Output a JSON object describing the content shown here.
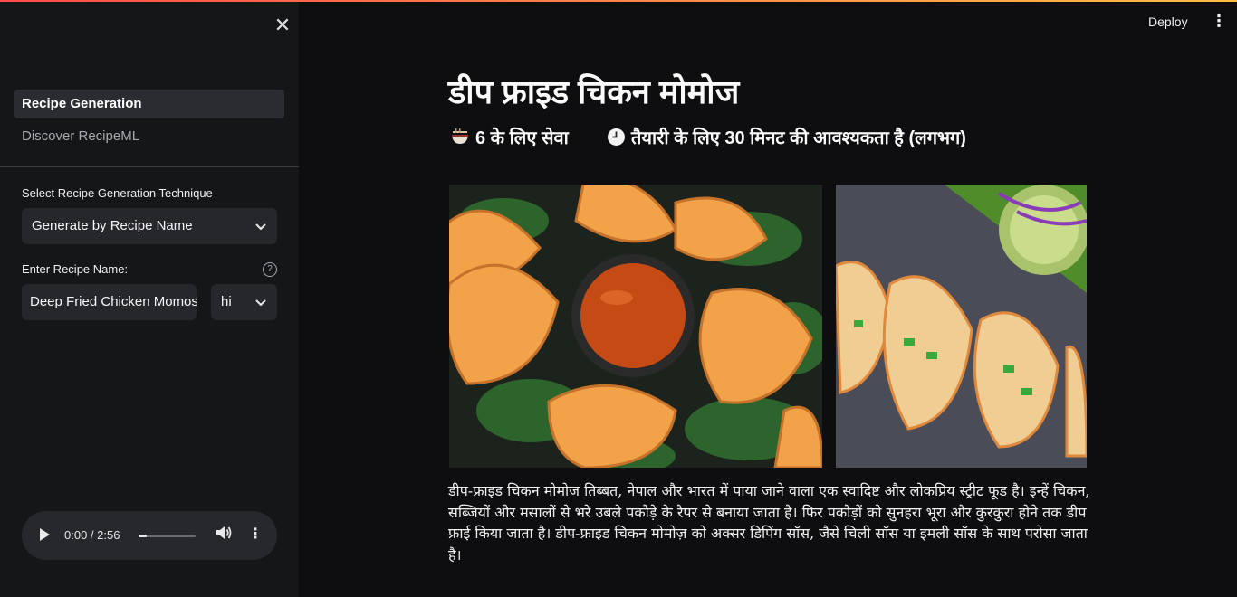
{
  "sidebar": {
    "close_glyph": "✕",
    "nav": [
      {
        "label": "Recipe Generation",
        "active": true
      },
      {
        "label": "Discover RecipeML",
        "active": false
      }
    ],
    "technique_label": "Select Recipe Generation Technique",
    "technique_value": "Generate by Recipe Name",
    "recipe_name_label": "Enter Recipe Name:",
    "recipe_name_value": "Deep Fried Chicken Momos",
    "language_value": "hi",
    "help_glyph": "?",
    "audio": {
      "time": "0:00 / 2:56",
      "progress": 0.0
    }
  },
  "header": {
    "deploy_label": "Deploy"
  },
  "main": {
    "title": "डीप फ्राइड चिकन मोमोज",
    "serves": "6 के लिए सेवा",
    "prep_time": "तैयारी के लिए 30 मिनट की आवश्यकता है (लगभग)",
    "description": "डीप-फ्राइड चिकन मोमोज तिब्बत, नेपाल और भारत में पाया जाने वाला एक स्वादिष्ट और लोकप्रिय स्ट्रीट फूड है। इन्हें चिकन, सब्जियों और मसालों से भरे उबले पकौड़े के रैपर से बनाया जाता है। फिर पकौड़ों को सुनहरा भूरा और कुरकुरा होने तक डीप फ्राई किया जाता है। डीप-फ्राइड चिकन मोमोज़ को अक्सर डिपिंग सॉस, जैसे चिली सॉस या इमली सॉस के साथ परोसा जाता है।"
  },
  "icons": {
    "bowl": "bowl-icon",
    "clock": "clock-icon"
  },
  "colors": {
    "accent_start": "#ff4b4b",
    "accent_end": "#ffbd45",
    "background": "#0e0e10",
    "sidebar": "#151618"
  }
}
